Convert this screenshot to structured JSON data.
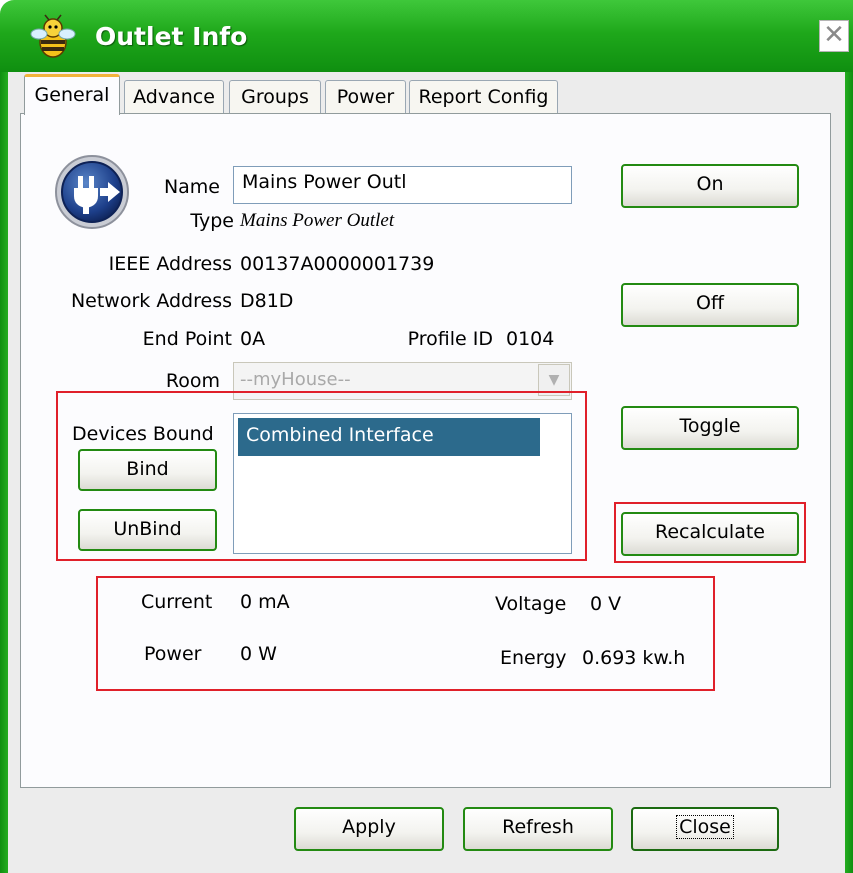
{
  "window": {
    "title": "Outlet Info",
    "close_glyph": "✕"
  },
  "tabs": [
    {
      "label": "General",
      "active": true
    },
    {
      "label": "Advance",
      "active": false
    },
    {
      "label": "Groups",
      "active": false
    },
    {
      "label": "Power",
      "active": false
    },
    {
      "label": "Report Config",
      "active": false
    }
  ],
  "device": {
    "icon": "power-plug-icon",
    "name_label": "Name",
    "name_value": "Mains Power Outl",
    "type_label": "Type",
    "type_value": "Mains Power Outlet",
    "ieee_label": "IEEE Address",
    "ieee_value": "00137A0000001739",
    "network_label": "Network Address",
    "network_value": "D81D",
    "endpoint_label": "End Point",
    "endpoint_value": "0A",
    "profile_label": "Profile ID",
    "profile_value": "0104",
    "room_label": "Room",
    "room_value": "--myHouse--"
  },
  "binding": {
    "label": "Devices Bound",
    "bind_button": "Bind",
    "unbind_button": "UnBind",
    "items": [
      "Combined Interface"
    ]
  },
  "actions": {
    "on": "On",
    "off": "Off",
    "toggle": "Toggle",
    "recalculate": "Recalculate"
  },
  "measurements": {
    "current_label": "Current",
    "current_value": "0 mA",
    "power_label": "Power",
    "power_value": "0 W",
    "voltage_label": "Voltage",
    "voltage_value": "0 V",
    "energy_label": "Energy",
    "energy_value": "0.693 kw.h"
  },
  "footer": {
    "apply": "Apply",
    "refresh": "Refresh",
    "close": "Close"
  },
  "colors": {
    "titlebar": "#1fa81b",
    "selection": "#2c6a8c",
    "highlight_box": "#e0202a",
    "active_tab_accent": "#f2b33a",
    "button_border": "#238a12"
  }
}
